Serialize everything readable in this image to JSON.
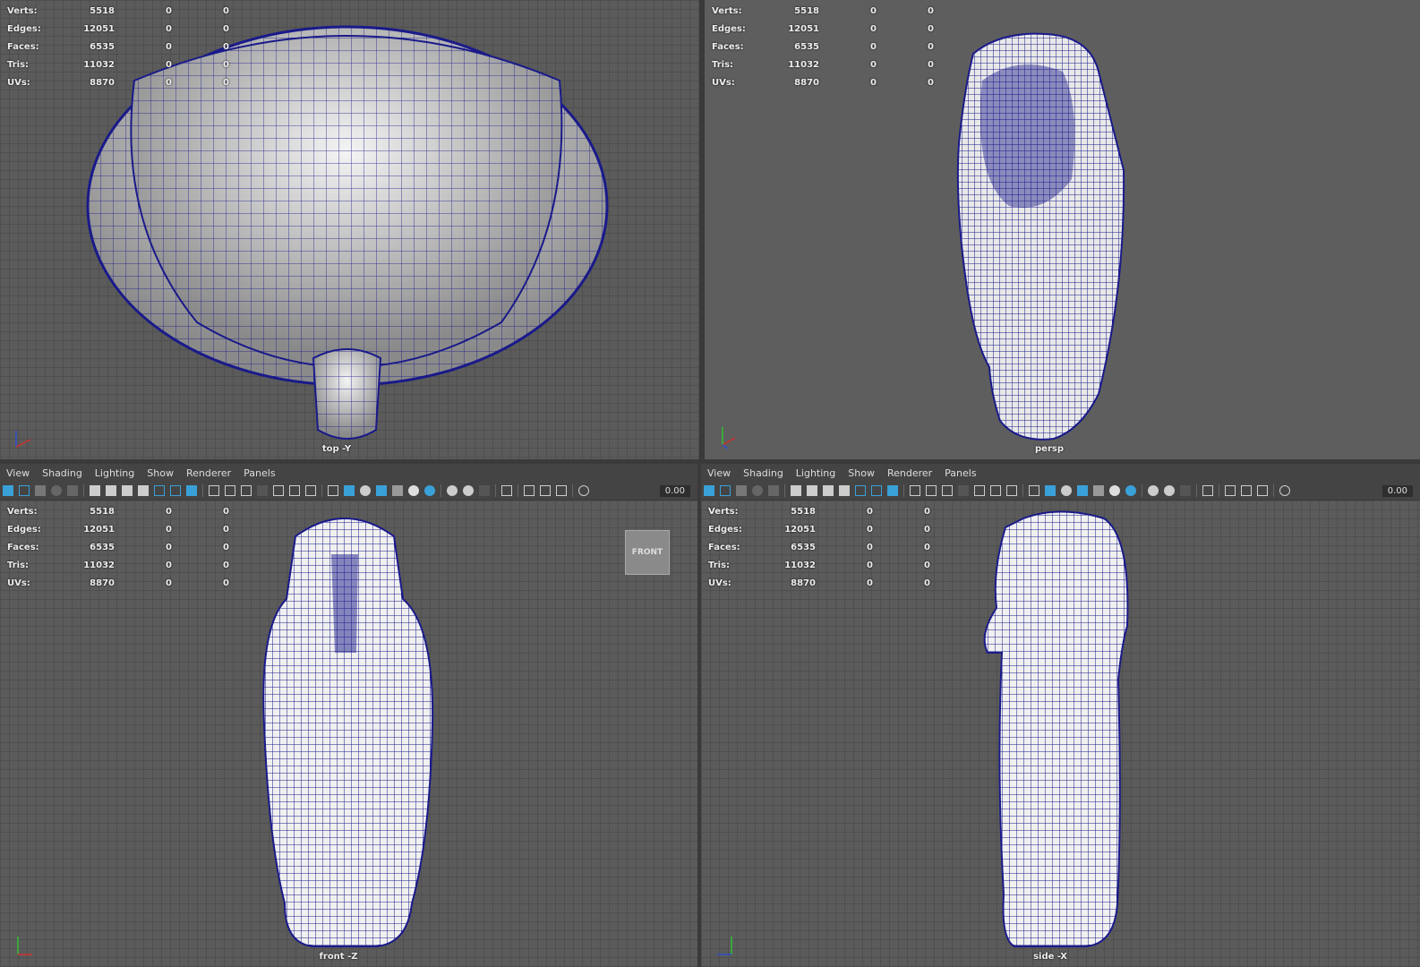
{
  "stats": {
    "rows": [
      {
        "label": "Verts:",
        "v1": "5518",
        "v2": "0",
        "v3": "0"
      },
      {
        "label": "Edges:",
        "v1": "12051",
        "v2": "0",
        "v3": "0"
      },
      {
        "label": "Faces:",
        "v1": "6535",
        "v2": "0",
        "v3": "0"
      },
      {
        "label": "Tris:",
        "v1": "11032",
        "v2": "0",
        "v3": "0"
      },
      {
        "label": "UVs:",
        "v1": "8870",
        "v2": "0",
        "v3": "0"
      }
    ]
  },
  "viewports": {
    "top": {
      "camera": "top -Y"
    },
    "persp": {
      "camera": "persp"
    },
    "front": {
      "camera": "front -Z",
      "viewcube": "FRONT"
    },
    "side": {
      "camera": "side -X"
    }
  },
  "menu": [
    "View",
    "Shading",
    "Lighting",
    "Show",
    "Renderer",
    "Panels"
  ],
  "toolbar": {
    "field_value": "0.00"
  },
  "colors": {
    "wire": "#1a1a8a",
    "shade": "#e6e6e6",
    "axis_x": "#d03030",
    "axis_y": "#30c030",
    "axis_z": "#3050d0"
  }
}
